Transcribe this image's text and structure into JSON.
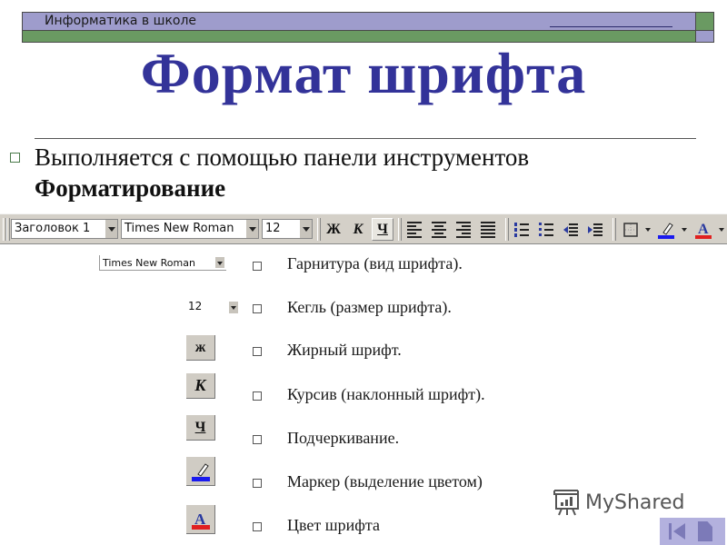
{
  "header": {
    "title": "Информатика в школе",
    "colors": {
      "bar_top": "#9e9ccc",
      "bar_bottom": "#6a9a62"
    }
  },
  "slide": {
    "title": "Формат шрифта",
    "title_color": "#333399",
    "intro_line1": "Выполняется с помощью панели инструментов",
    "intro_line2": "Форматирование"
  },
  "toolbar": {
    "style_value": "Заголовок 1",
    "font_value": "Times New Roman",
    "size_value": "12",
    "bold_label": "Ж",
    "italic_label": "К",
    "underline_label": "Ч",
    "highlight_color": "#1a1aee",
    "font_color": "#e02020"
  },
  "samples": {
    "font_value": "Times New Roman",
    "size_value": "12",
    "bold_label": "ж",
    "italic_label": "К",
    "underline_label": "Ч"
  },
  "items": [
    {
      "text": "Гарнитура (вид шрифта)."
    },
    {
      "text": "Кегль  (размер шрифта)."
    },
    {
      "text": "Жирный шрифт."
    },
    {
      "text": "Курсив (наклонный шрифт)."
    },
    {
      "text": "Подчеркивание."
    },
    {
      "text": "Маркер  (выделение цветом)"
    },
    {
      "text": "Цвет шрифта"
    }
  ],
  "watermark": {
    "text": "MyShared"
  },
  "nav": {
    "prev_icon": "first-slide-icon",
    "doc_icon": "page-icon"
  }
}
